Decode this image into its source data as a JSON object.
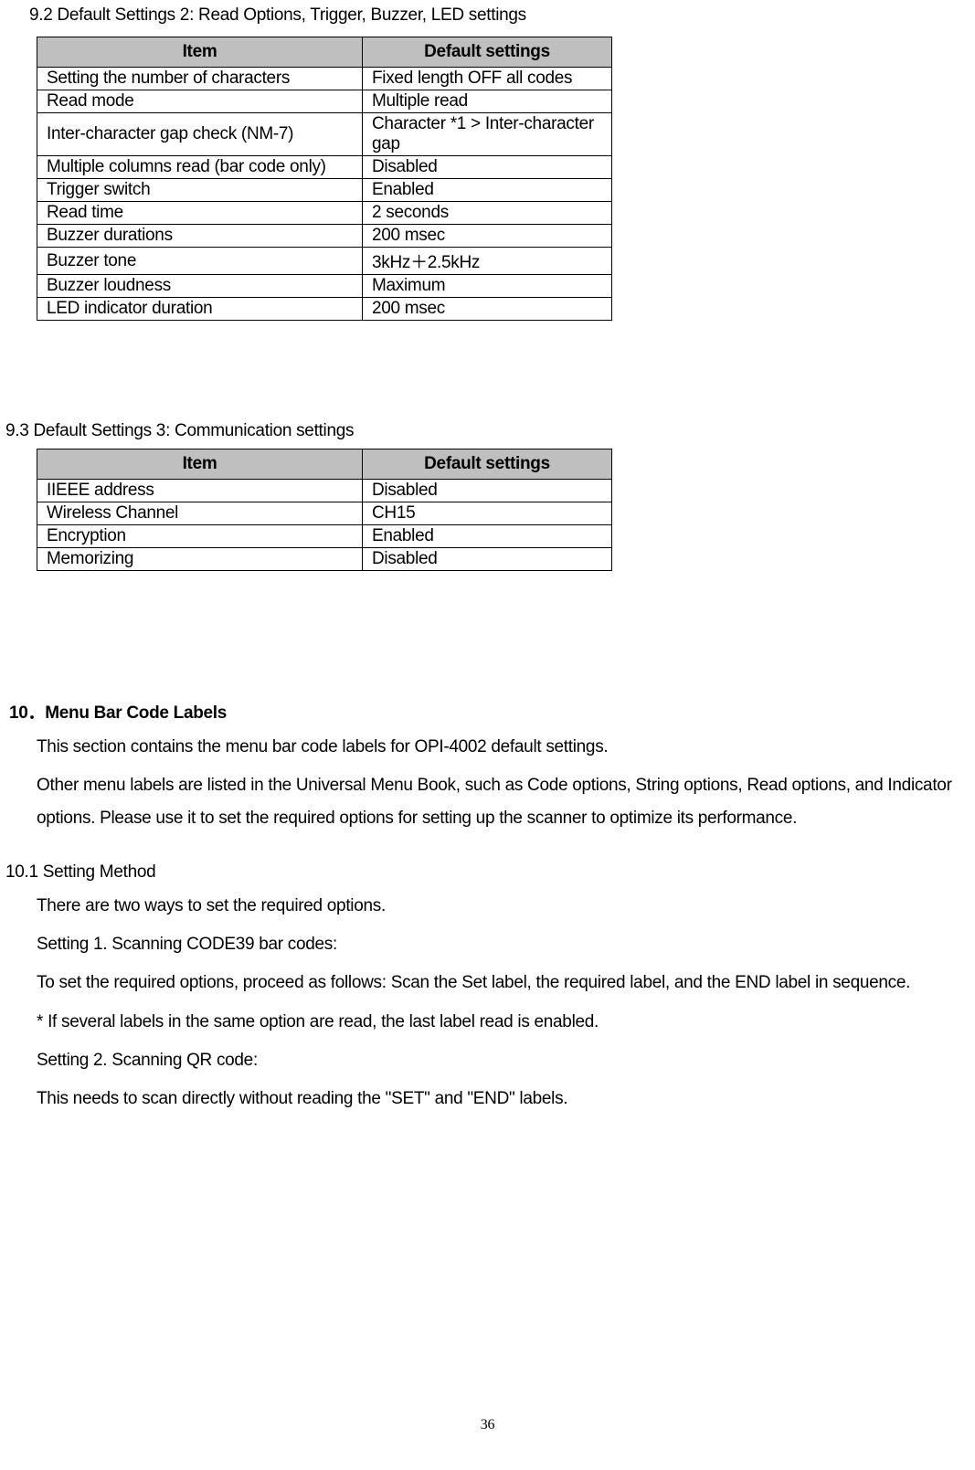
{
  "section92": {
    "heading": "9.2    Default Settings 2: Read Options, Trigger, Buzzer, LED settings",
    "headers": [
      "Item",
      "Default settings"
    ],
    "rows": [
      [
        "Setting the number of characters",
        "Fixed length OFF all codes"
      ],
      [
        "Read mode",
        "Multiple read"
      ],
      [
        "Inter-character gap check (NM-7)",
        "Character *1 > Inter-character gap"
      ],
      [
        " Multiple columns read (bar code only)",
        " Disabled"
      ],
      [
        "Trigger switch",
        "Enabled"
      ],
      [
        "Read time",
        "2 seconds"
      ],
      [
        "Buzzer durations",
        "200 msec"
      ],
      [
        "Buzzer tone",
        "3kHz＋2.5kHz"
      ],
      [
        "Buzzer loudness",
        "Maximum"
      ],
      [
        "LED indicator duration",
        "200 msec"
      ]
    ]
  },
  "section93": {
    "heading": "9.3 Default Settings 3: Communication settings",
    "headers": [
      "Item",
      "Default settings"
    ],
    "rows": [
      [
        "IIEEE address",
        "Disabled"
      ],
      [
        "Wireless Channel",
        "CH15"
      ],
      [
        "Encryption",
        "Enabled"
      ],
      [
        "Memorizing",
        "Disabled"
      ]
    ]
  },
  "section10": {
    "num": "10．",
    "title": "Menu Bar Code Labels",
    "p1": "This section contains the menu bar code labels for OPI-4002 default settings.",
    "p2": "Other menu labels are listed in the Universal Menu Book, such as Code options, String options, Read options, and Indicator options.    Please use it to set the required options for setting up the scanner to optimize its performance."
  },
  "section101": {
    "heading": "10.1 Setting Method",
    "p1": "There are two ways to set the required options.",
    "p2": "Setting 1. Scanning CODE39 bar codes:",
    "p3": "To set the required options, proceed as follows: Scan the Set label, the required label, and the END label in sequence.",
    "p4": "* If several labels in the same option are read, the last label read is enabled.",
    "p5": "Setting 2. Scanning QR code:",
    "p6": "This needs to scan directly without reading the \"SET\" and \"END\" labels."
  },
  "pageNumber": "36",
  "chart_data": [
    {
      "type": "table",
      "title": "Default Settings 2: Read Options, Trigger, Buzzer, LED settings",
      "columns": [
        "Item",
        "Default settings"
      ],
      "rows": [
        [
          "Setting the number of characters",
          "Fixed length OFF all codes"
        ],
        [
          "Read mode",
          "Multiple read"
        ],
        [
          "Inter-character gap check (NM-7)",
          "Character *1 > Inter-character gap"
        ],
        [
          "Multiple columns read (bar code only)",
          "Disabled"
        ],
        [
          "Trigger switch",
          "Enabled"
        ],
        [
          "Read time",
          "2 seconds"
        ],
        [
          "Buzzer durations",
          "200 msec"
        ],
        [
          "Buzzer tone",
          "3kHz＋2.5kHz"
        ],
        [
          "Buzzer loudness",
          "Maximum"
        ],
        [
          "LED indicator duration",
          "200 msec"
        ]
      ]
    },
    {
      "type": "table",
      "title": "Default Settings 3: Communication settings",
      "columns": [
        "Item",
        "Default settings"
      ],
      "rows": [
        [
          "IIEEE address",
          "Disabled"
        ],
        [
          "Wireless Channel",
          "CH15"
        ],
        [
          "Encryption",
          "Enabled"
        ],
        [
          "Memorizing",
          "Disabled"
        ]
      ]
    }
  ]
}
